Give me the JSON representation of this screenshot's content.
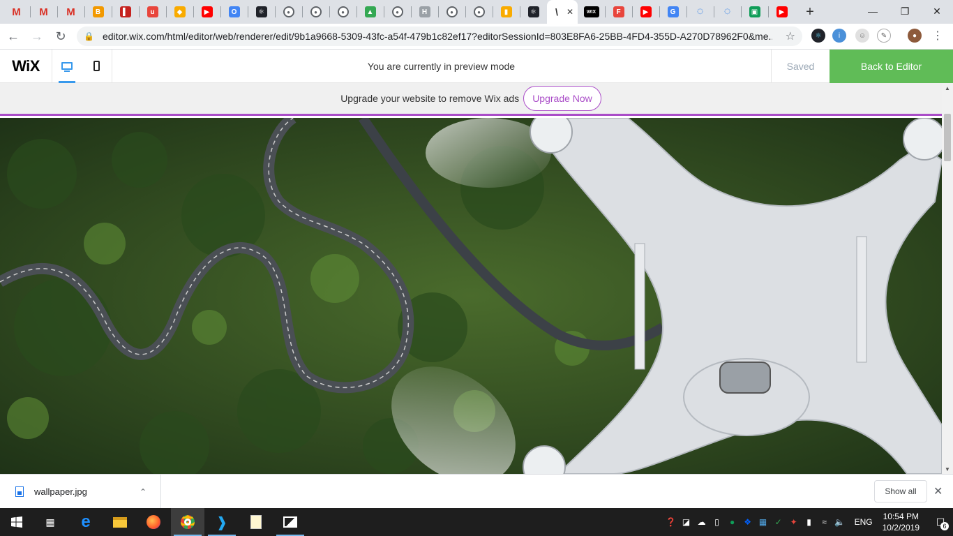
{
  "browser": {
    "tabs": [
      {
        "icon": "gmail-icon",
        "glyph": "M",
        "color": "#d93025"
      },
      {
        "icon": "gmail-icon",
        "glyph": "M",
        "color": "#d93025"
      },
      {
        "icon": "gmail-icon",
        "glyph": "M",
        "color": "#d93025"
      },
      {
        "icon": "orange-app-icon",
        "glyph": "B",
        "color": "#f29900"
      },
      {
        "icon": "red-books-icon",
        "glyph": "▌",
        "color": "#c5221f"
      },
      {
        "icon": "red-script-icon",
        "glyph": "u",
        "color": "#e8453c"
      },
      {
        "icon": "yellow-icon",
        "glyph": "◆",
        "color": "#f9ab00"
      },
      {
        "icon": "youtube-icon",
        "glyph": "▶",
        "color": "#ff0000"
      },
      {
        "icon": "chrome-like-icon",
        "glyph": "O",
        "color": "#4285f4"
      },
      {
        "icon": "react-icon",
        "glyph": "⚛",
        "color": "#20232a"
      },
      {
        "icon": "github-icon",
        "glyph": "●",
        "color": "#5f6368"
      },
      {
        "icon": "github-icon",
        "glyph": "●",
        "color": "#5f6368"
      },
      {
        "icon": "github-icon",
        "glyph": "●",
        "color": "#5f6368"
      },
      {
        "icon": "tree-icon",
        "glyph": "▲",
        "color": "#34a853"
      },
      {
        "icon": "github-icon",
        "glyph": "●",
        "color": "#5f6368"
      },
      {
        "icon": "h-icon",
        "glyph": "H",
        "color": "#9aa0a6"
      },
      {
        "icon": "github-icon",
        "glyph": "●",
        "color": "#5f6368"
      },
      {
        "icon": "github-icon",
        "glyph": "●",
        "color": "#5f6368"
      },
      {
        "icon": "analytics-icon",
        "glyph": "▮",
        "color": "#f9ab00"
      },
      {
        "icon": "react-icon",
        "glyph": "⚛",
        "color": "#20232a"
      }
    ],
    "active_tab": {
      "glyph": "\\",
      "close": "✕"
    },
    "tabs_after": [
      {
        "icon": "wix-icon",
        "glyph": "WIX",
        "color": "#000000"
      },
      {
        "icon": "f-icon",
        "glyph": "F",
        "color": "#e8453c"
      },
      {
        "icon": "youtube-icon",
        "glyph": "▶",
        "color": "#ff0000"
      },
      {
        "icon": "google-icon",
        "glyph": "G",
        "color": "#4285f4"
      },
      {
        "icon": "loading-icon",
        "glyph": "◌",
        "color": "#1a73e8"
      },
      {
        "icon": "loading-icon",
        "glyph": "◌",
        "color": "#1a73e8"
      },
      {
        "icon": "green-app-icon",
        "glyph": "▣",
        "color": "#0f9d58"
      },
      {
        "icon": "youtube-icon",
        "glyph": "▶",
        "color": "#ff0000"
      }
    ],
    "new_tab": "+",
    "window": {
      "minimize": "—",
      "maximize": "❐",
      "close": "✕"
    },
    "url": "editor.wix.com/html/editor/web/renderer/edit/9b1a9668-5309-43fc-a54f-479b1c82ef17?editorSessionId=803E8FA6-25BB-4FD4-355D-A270D78962F0&me..."
  },
  "wix": {
    "logo": "WiX",
    "preview_message": "You are currently in preview mode",
    "saved": "Saved",
    "back_to_editor": "Back to Editor",
    "upgrade_text": "Upgrade your website to remove Wix ads",
    "upgrade_button": "Upgrade Now"
  },
  "downloads": {
    "file": "wallpaper.jpg",
    "show_all": "Show all"
  },
  "taskbar": {
    "language": "ENG",
    "time": "10:54 PM",
    "date": "10/2/2019",
    "notifications": "6"
  }
}
